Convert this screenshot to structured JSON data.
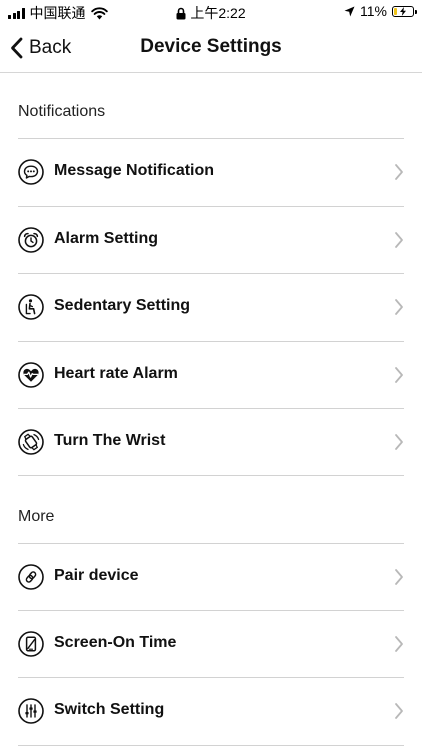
{
  "status_bar": {
    "carrier": "中国联通",
    "time": "上午2:22",
    "battery": "11%"
  },
  "nav": {
    "back_label": "Back",
    "title": "Device Settings"
  },
  "sections": [
    {
      "title": "Notifications",
      "items": [
        {
          "label": "Message Notification",
          "icon": "message-icon"
        },
        {
          "label": "Alarm Setting",
          "icon": "alarm-clock-icon"
        },
        {
          "label": "Sedentary Setting",
          "icon": "sedentary-icon"
        },
        {
          "label": "Heart rate Alarm",
          "icon": "heart-rate-icon"
        },
        {
          "label": "Turn The Wrist",
          "icon": "wrist-icon"
        }
      ]
    },
    {
      "title": "More",
      "items": [
        {
          "label": "Pair device",
          "icon": "link-icon"
        },
        {
          "label": "Screen-On Time",
          "icon": "screen-icon"
        },
        {
          "label": "Switch Setting",
          "icon": "sliders-icon"
        }
      ]
    }
  ]
}
